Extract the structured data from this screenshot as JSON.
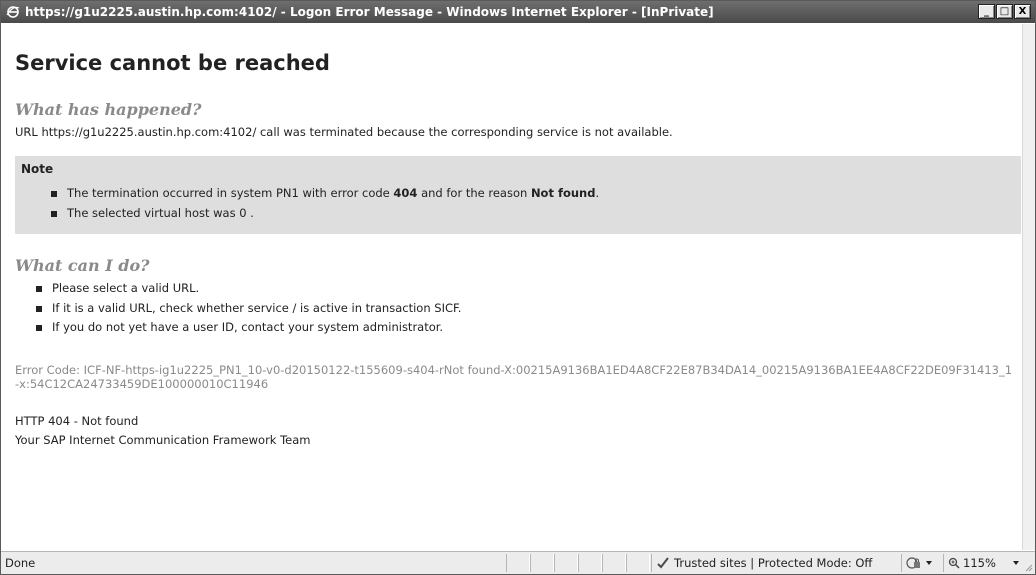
{
  "window": {
    "title": "https://g1u2225.austin.hp.com:4102/ - Logon Error Message - Windows Internet Explorer - [InPrivate]",
    "buttons": {
      "minimize": "_",
      "maximize": "□",
      "close": "X"
    }
  },
  "page": {
    "title": "Service cannot be reached",
    "happened_heading": "What has happened?",
    "happened_text": "URL https://g1u2225.austin.hp.com:4102/ call was terminated because the corresponding service is not available.",
    "note": {
      "title": "Note",
      "item1_prefix": "The termination occurred in system PN1 with error code ",
      "item1_code": "404",
      "item1_middle": " and for the reason ",
      "item1_reason": "Not found",
      "item1_suffix": ".",
      "item2": "The selected virtual host was 0 ."
    },
    "help_heading": "What can I do?",
    "help_items": [
      "Please select a valid URL.",
      "If it is a valid URL, check whether service / is active in transaction SICF.",
      "If you do not yet have a user ID, contact your system administrator."
    ],
    "error_code": "Error Code: ICF-NF-https-ig1u2225_PN1_10-v0-d20150122-t155609-s404-rNot found-X:00215A9136BA1ED4A8CF22E87B34DA14_00215A9136BA1EE4A8CF22DE09F31413_1-x:54C12CA24733459DE100000010C11946",
    "http_status": "HTTP 404 - Not found",
    "signature": "Your SAP Internet Communication Framework Team"
  },
  "statusbar": {
    "status": "Done",
    "zone": "Trusted sites | Protected Mode: Off",
    "zoom": "115%"
  },
  "icons": {
    "browser": "ie-icon",
    "zone": "check-icon",
    "protected_mode": "lock-icon",
    "zoom": "zoom-icon"
  }
}
